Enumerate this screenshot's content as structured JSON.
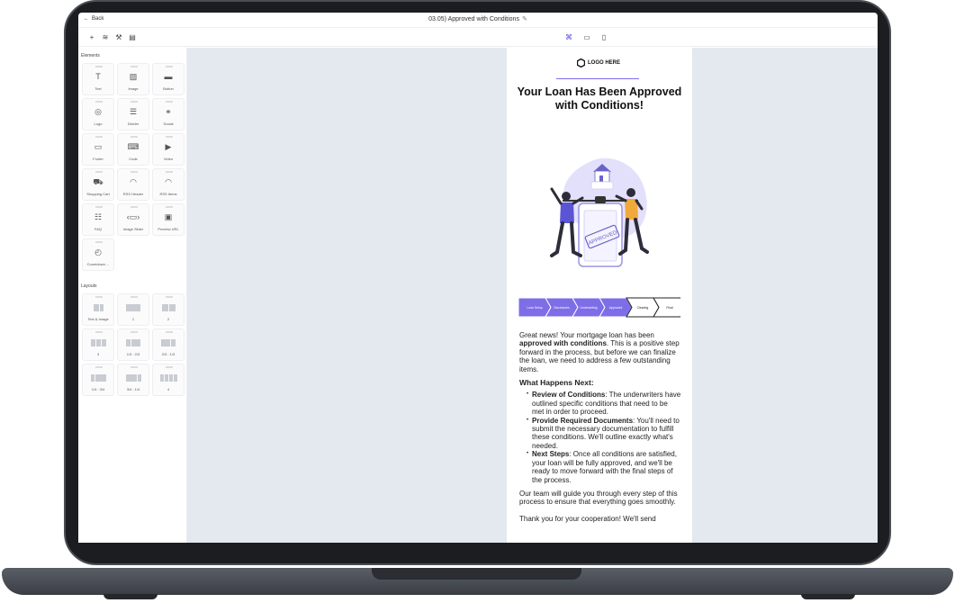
{
  "topbar": {
    "back_label": "Back",
    "title": "03.05) Approved with Conditions"
  },
  "sidebar": {
    "elements_title": "Elements",
    "elements": [
      {
        "label": "Text",
        "icon": "text-icon",
        "glyph": "T"
      },
      {
        "label": "Image",
        "icon": "image-icon",
        "glyph": "▨"
      },
      {
        "label": "Button",
        "icon": "button-icon",
        "glyph": "▬"
      },
      {
        "label": "Logo",
        "icon": "logo-icon",
        "glyph": "◎"
      },
      {
        "label": "Divider",
        "icon": "divider-icon",
        "glyph": "☰"
      },
      {
        "label": "Social",
        "icon": "social-icon",
        "glyph": "⚭"
      },
      {
        "label": "Footer",
        "icon": "footer-icon",
        "glyph": "▭"
      },
      {
        "label": "Code",
        "icon": "code-icon",
        "glyph": "⌨"
      },
      {
        "label": "Video",
        "icon": "video-icon",
        "glyph": "▶"
      },
      {
        "label": "Shopping Cart",
        "icon": "cart-icon",
        "glyph": "⛟"
      },
      {
        "label": "RSS Header",
        "icon": "rss-icon",
        "glyph": "◠"
      },
      {
        "label": "RSS Items",
        "icon": "rss-icon",
        "glyph": "◠"
      },
      {
        "label": "FAQ",
        "icon": "faq-icon",
        "glyph": "☷"
      },
      {
        "label": "Image Slider",
        "icon": "slider-icon",
        "glyph": "‹▭›"
      },
      {
        "label": "Preview URL",
        "icon": "preview-url-icon",
        "glyph": "▣"
      },
      {
        "label": "Countdown ...",
        "icon": "countdown-icon",
        "glyph": "◴"
      }
    ],
    "layouts_title": "Layouts",
    "layouts": [
      {
        "label": "Text & Image"
      },
      {
        "label": "1"
      },
      {
        "label": "2"
      },
      {
        "label": "3"
      },
      {
        "label": "1/3 : 2/3"
      },
      {
        "label": "2/3 : 1/3"
      },
      {
        "label": "1/4 : 3/4"
      },
      {
        "label": "3/4 : 1/4"
      },
      {
        "label": "4"
      }
    ]
  },
  "email": {
    "logo_text": "LOGO HERE",
    "headline": "Your Loan Has Been Approved with Conditions!",
    "stamp_text": "APPROVED",
    "steps": [
      "Loan Setup",
      "Disclosures",
      "Underwriting",
      "Approved",
      "Clearing",
      "Final"
    ],
    "intro_1": "Great news! Your mortgage loan has been ",
    "intro_bold": "approved with conditions",
    "intro_2": ". This is a positive step forward in the process, but before we can finalize the loan, we need to address a few outstanding items.",
    "next_heading": "What Happens Next:",
    "bullets": [
      {
        "bold": "Review of Conditions",
        "text": ": The underwriters have outlined specific conditions that need to be met in order to proceed."
      },
      {
        "bold": "Provide Required Documents",
        "text": ": You'll need to submit the necessary documentation to fulfill these conditions. We'll outline exactly what's needed."
      },
      {
        "bold": "Next Steps",
        "text": ": Once all conditions are satisfied, your loan will be fully approved, and we'll be ready to move forward with the final steps of the process."
      }
    ],
    "outro": "Our team will guide you through every step of this process to ensure that everything goes smoothly.",
    "thanks": "Thank you for your cooperation! We'll send"
  },
  "colors": {
    "accent": "#7d6ee8",
    "canvas_bg": "#e4e9ef",
    "figure_blue": "#5b55d6",
    "figure_yellow": "#f2a93b"
  }
}
